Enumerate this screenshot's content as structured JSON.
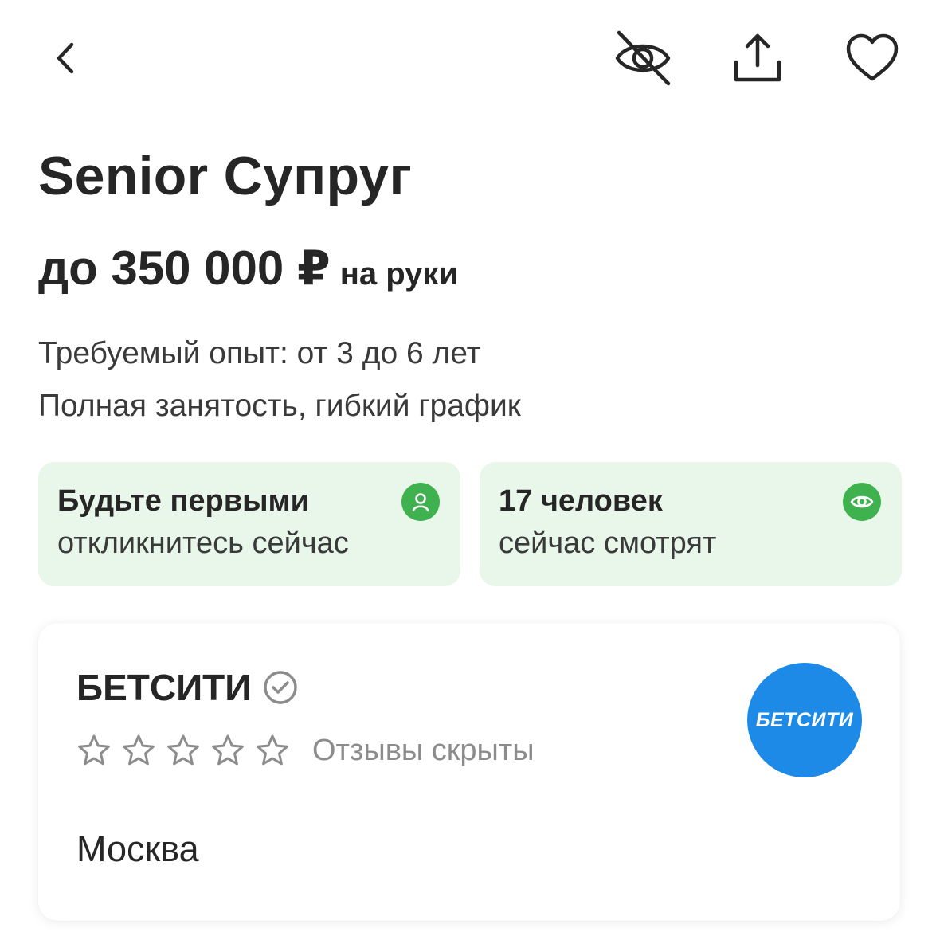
{
  "header": {
    "back_icon": "chevron-left-icon",
    "hide_icon": "eye-off-icon",
    "share_icon": "share-upload-icon",
    "favorite_icon": "heart-icon"
  },
  "vacancy": {
    "title": "Senior Супруг",
    "salary_amount": "до 350 000 ₽",
    "salary_suffix": "на руки",
    "experience": "Требуемый опыт: от 3 до 6 лет",
    "employment": "Полная занятость, гибкий график"
  },
  "stats": {
    "first": {
      "title": "Будьте первыми",
      "subtitle": "откликнитесь сейчас",
      "icon": "person-icon"
    },
    "viewers": {
      "title": "17 человек",
      "subtitle": "сейчас смотрят",
      "icon": "eye-icon"
    },
    "card_color": "#e8f7ea",
    "icon_color": "#3fb24f"
  },
  "company": {
    "name": "БЕТСИТИ",
    "verified_icon": "check-circle-icon",
    "rating_stars": 0,
    "rating_max": 5,
    "reviews_text": "Отзывы скрыты",
    "city": "Москва",
    "logo_text": "БЕТСИТИ",
    "logo_color": "#1d8ae8"
  }
}
